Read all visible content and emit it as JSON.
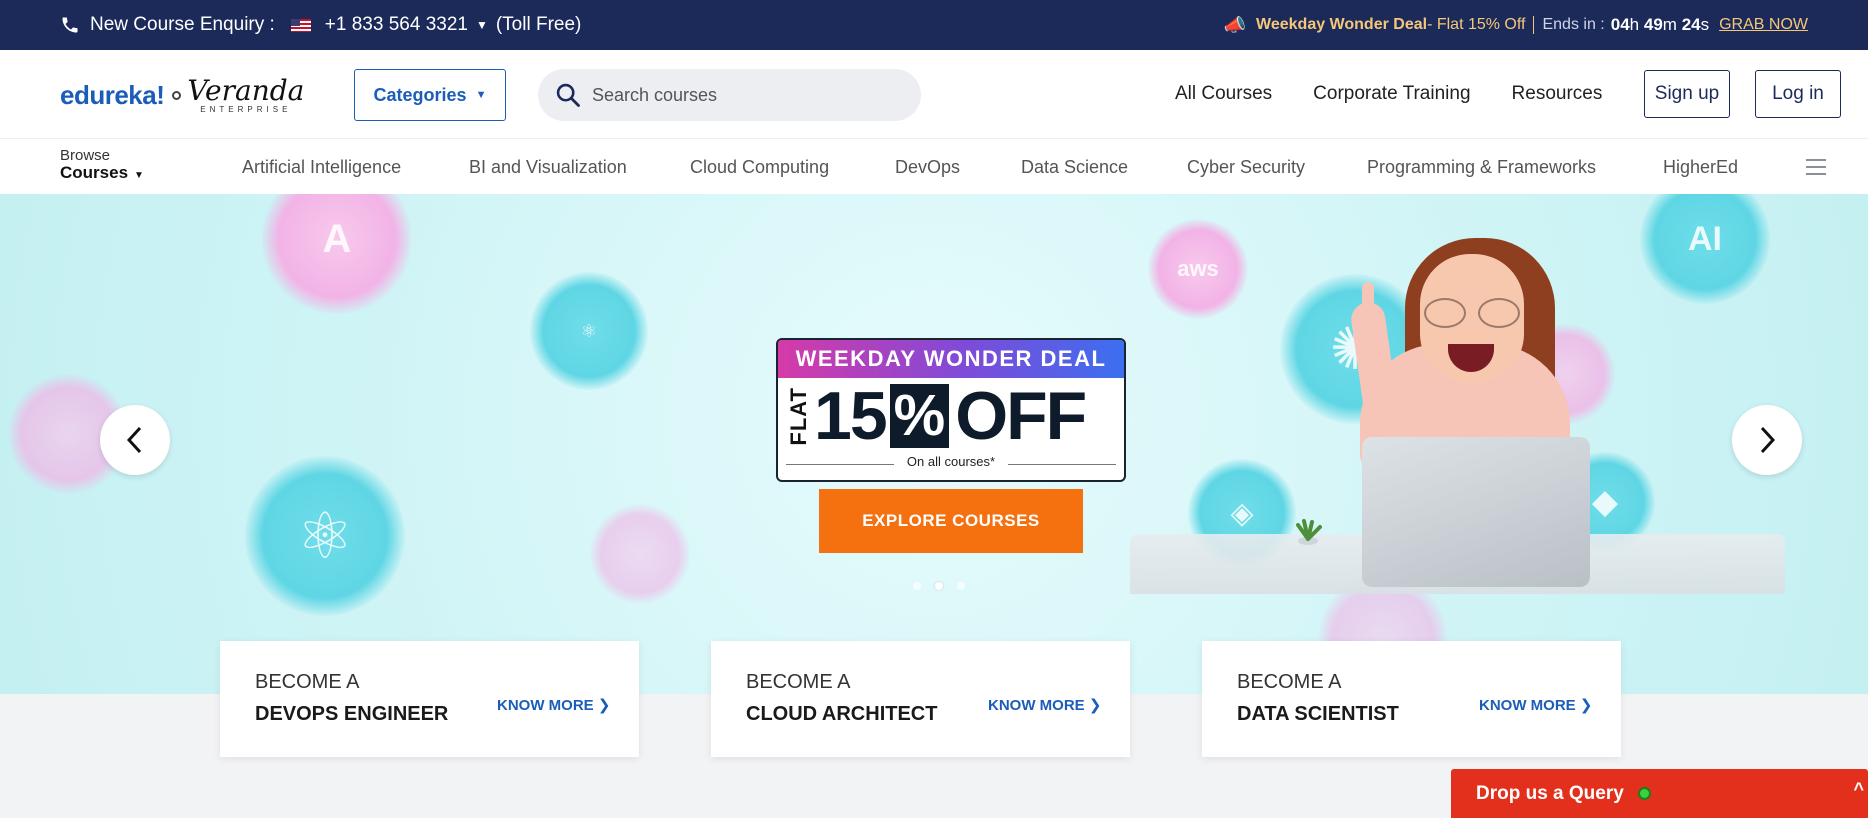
{
  "topbar": {
    "enquiry_label": "New Course Enquiry :",
    "phone": "+1 833 564 3321",
    "toll_free": "(Toll Free)",
    "deal_title": "Weekday Wonder Deal",
    "deal_sub": " - Flat 15% Off",
    "ends_in": "Ends in :",
    "timer_h": "04",
    "timer_h_unit": "h",
    "timer_m": "49",
    "timer_m_unit": "m",
    "timer_s": "24",
    "timer_s_unit": "s",
    "grab": "GRAB NOW"
  },
  "header": {
    "logo_edureka": "edureka!",
    "logo_veranda": "Veranda",
    "logo_enterprise": "ENTERPRISE",
    "categories": "Categories",
    "search_placeholder": "Search courses",
    "links": [
      "All Courses",
      "Corporate Training",
      "Resources"
    ],
    "signup": "Sign up",
    "login": "Log in"
  },
  "subnav": {
    "browse": "Browse",
    "courses": "Courses",
    "items": [
      "Artificial Intelligence",
      "BI and Visualization",
      "Cloud Computing",
      "DevOps",
      "Data Science",
      "Cyber Security",
      "Programming & Frameworks",
      "HigherEd"
    ]
  },
  "hero": {
    "promo_top": "WEEKDAY WONDER DEAL",
    "promo_flat": "FLAT",
    "promo_num": "15",
    "promo_pct": "%",
    "promo_off": "OFF",
    "promo_note": "On all courses*",
    "explore": "EXPLORE COURSES",
    "bubble_ai": "AI",
    "bubble_aws": "aws",
    "slide_count": 3,
    "active_slide": 2
  },
  "cards": [
    {
      "line1": "BECOME A",
      "line2": "DEVOPS ENGINEER",
      "cta": "KNOW MORE"
    },
    {
      "line1": "BECOME A",
      "line2": "CLOUD ARCHITECT",
      "cta": "KNOW MORE"
    },
    {
      "line1": "BECOME A",
      "line2": "DATA SCIENTIST",
      "cta": "KNOW MORE"
    }
  ],
  "query": {
    "label": "Drop us a Query"
  },
  "colors": {
    "navy": "#1c2a5a",
    "brand_blue": "#1b5db8",
    "orange": "#f5700f",
    "query_red": "#e2301c",
    "deal_gold": "#f4c77a"
  }
}
